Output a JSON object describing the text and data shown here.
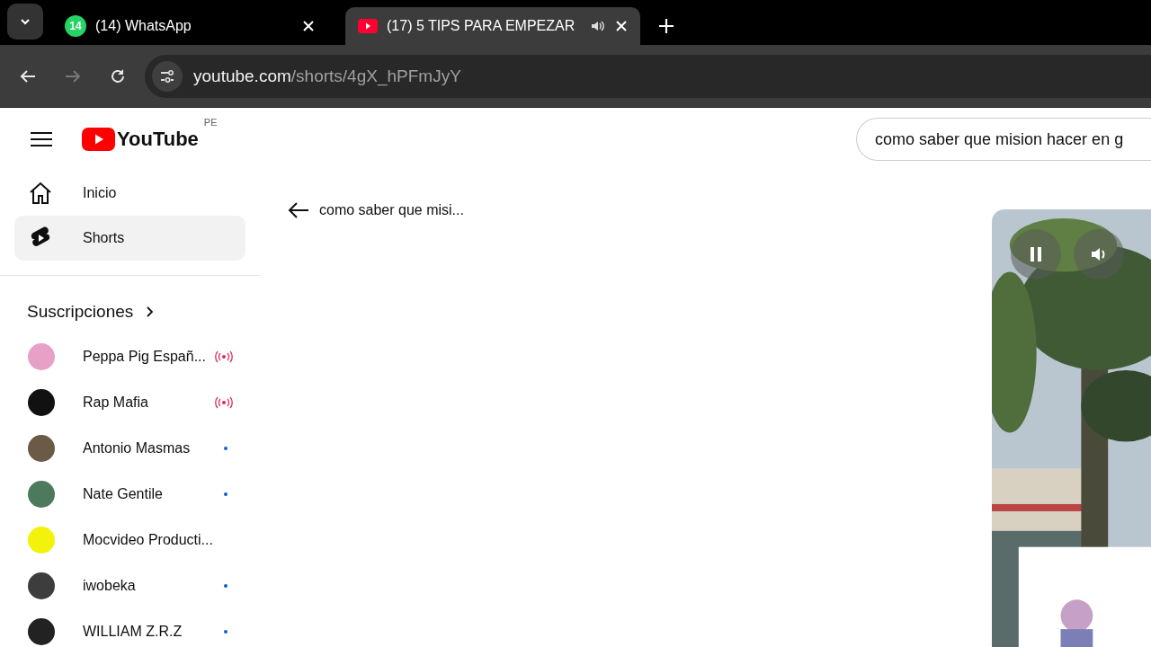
{
  "browser": {
    "tabs": [
      {
        "title": "(14) WhatsApp",
        "kind": "whatsapp",
        "badge": "14",
        "audio": false,
        "selected": false
      },
      {
        "title": "(17) 5 TIPS PARA EMPEZAR",
        "kind": "youtube",
        "audio": true,
        "selected": true
      }
    ],
    "address": {
      "domain": "youtube.com",
      "path": "/shorts/4gX_hPFmJyY"
    },
    "forward_disabled": true
  },
  "header": {
    "logo": "YouTube",
    "country": "PE",
    "search": {
      "value": "como saber que mision hacer en g"
    }
  },
  "sidebar": {
    "items": [
      {
        "label": "Inicio",
        "kind": "home",
        "selected": false
      },
      {
        "label": "Shorts",
        "kind": "shorts",
        "selected": true
      }
    ],
    "subscriptions_title": "Suscripciones",
    "subscriptions": [
      {
        "name": "Peppa Pig Españ...",
        "kind": "live",
        "color": "#e7a1c6"
      },
      {
        "name": "Rap Mafia",
        "kind": "live",
        "color": "#111111"
      },
      {
        "name": "Antonio Masmas",
        "kind": "new",
        "color": "#6b5a45"
      },
      {
        "name": "Nate Gentile",
        "kind": "new",
        "color": "#4d7a5c"
      },
      {
        "name": "Mocvideo Producti...",
        "kind": "none",
        "color": "#f2f20a"
      },
      {
        "name": "iwobeka",
        "kind": "new",
        "color": "#3d3d3d"
      },
      {
        "name": "WILLIAM Z.R.Z",
        "kind": "new",
        "color": "#222222"
      }
    ]
  },
  "main": {
    "back_title": "como saber que misi..."
  }
}
